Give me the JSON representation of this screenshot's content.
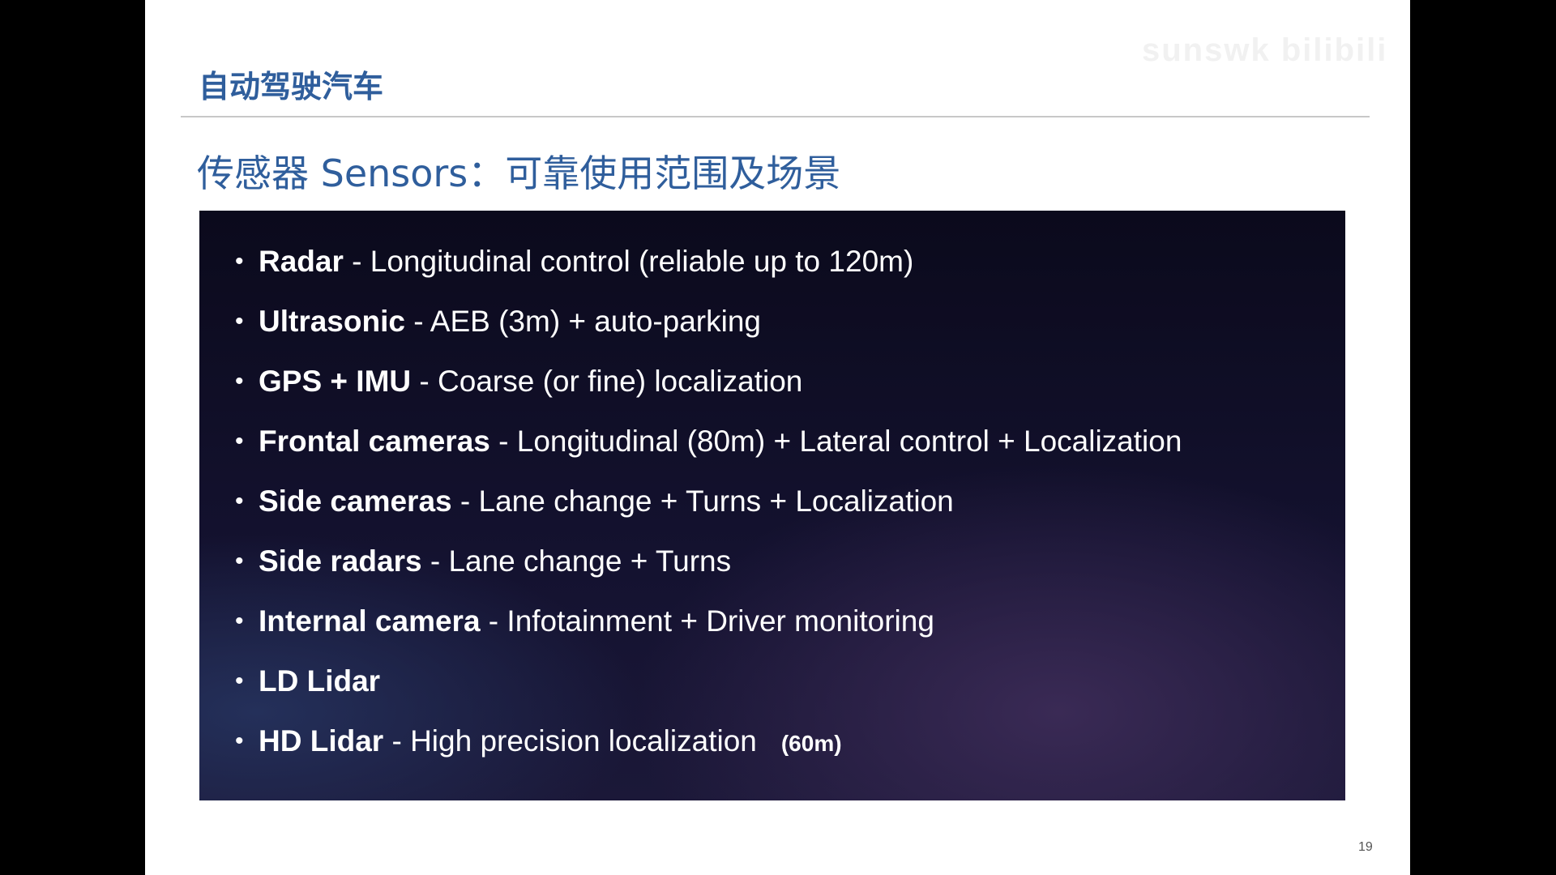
{
  "header": {
    "title": "自动驾驶汽车",
    "watermark": "sunswk bilibili"
  },
  "subtitle": "传感器 Sensors：可靠使用范围及场景",
  "bullets": [
    {
      "term": "Radar",
      "desc": " - Longitudinal control (reliable up to 120m)"
    },
    {
      "term": "Ultrasonic",
      "desc": " - AEB (3m) + auto-parking"
    },
    {
      "term": "GPS + IMU",
      "desc": " - Coarse (or fine) localization"
    },
    {
      "term": "Frontal cameras",
      "desc": " - Longitudinal (80m) + Lateral control + Localization"
    },
    {
      "term": "Side cameras",
      "desc": " - Lane change + Turns + Localization"
    },
    {
      "term": "Side radars",
      "desc": " - Lane change + Turns"
    },
    {
      "term": "Internal camera",
      "desc": " - Infotainment + Driver monitoring"
    },
    {
      "term": "LD Lidar",
      "desc": ""
    },
    {
      "term": "HD Lidar",
      "desc": " - High precision localization",
      "extra": "(60m)"
    }
  ],
  "page_number": "19",
  "colors": {
    "title": "#2f5e9c",
    "panel": "#0b0a1c"
  }
}
